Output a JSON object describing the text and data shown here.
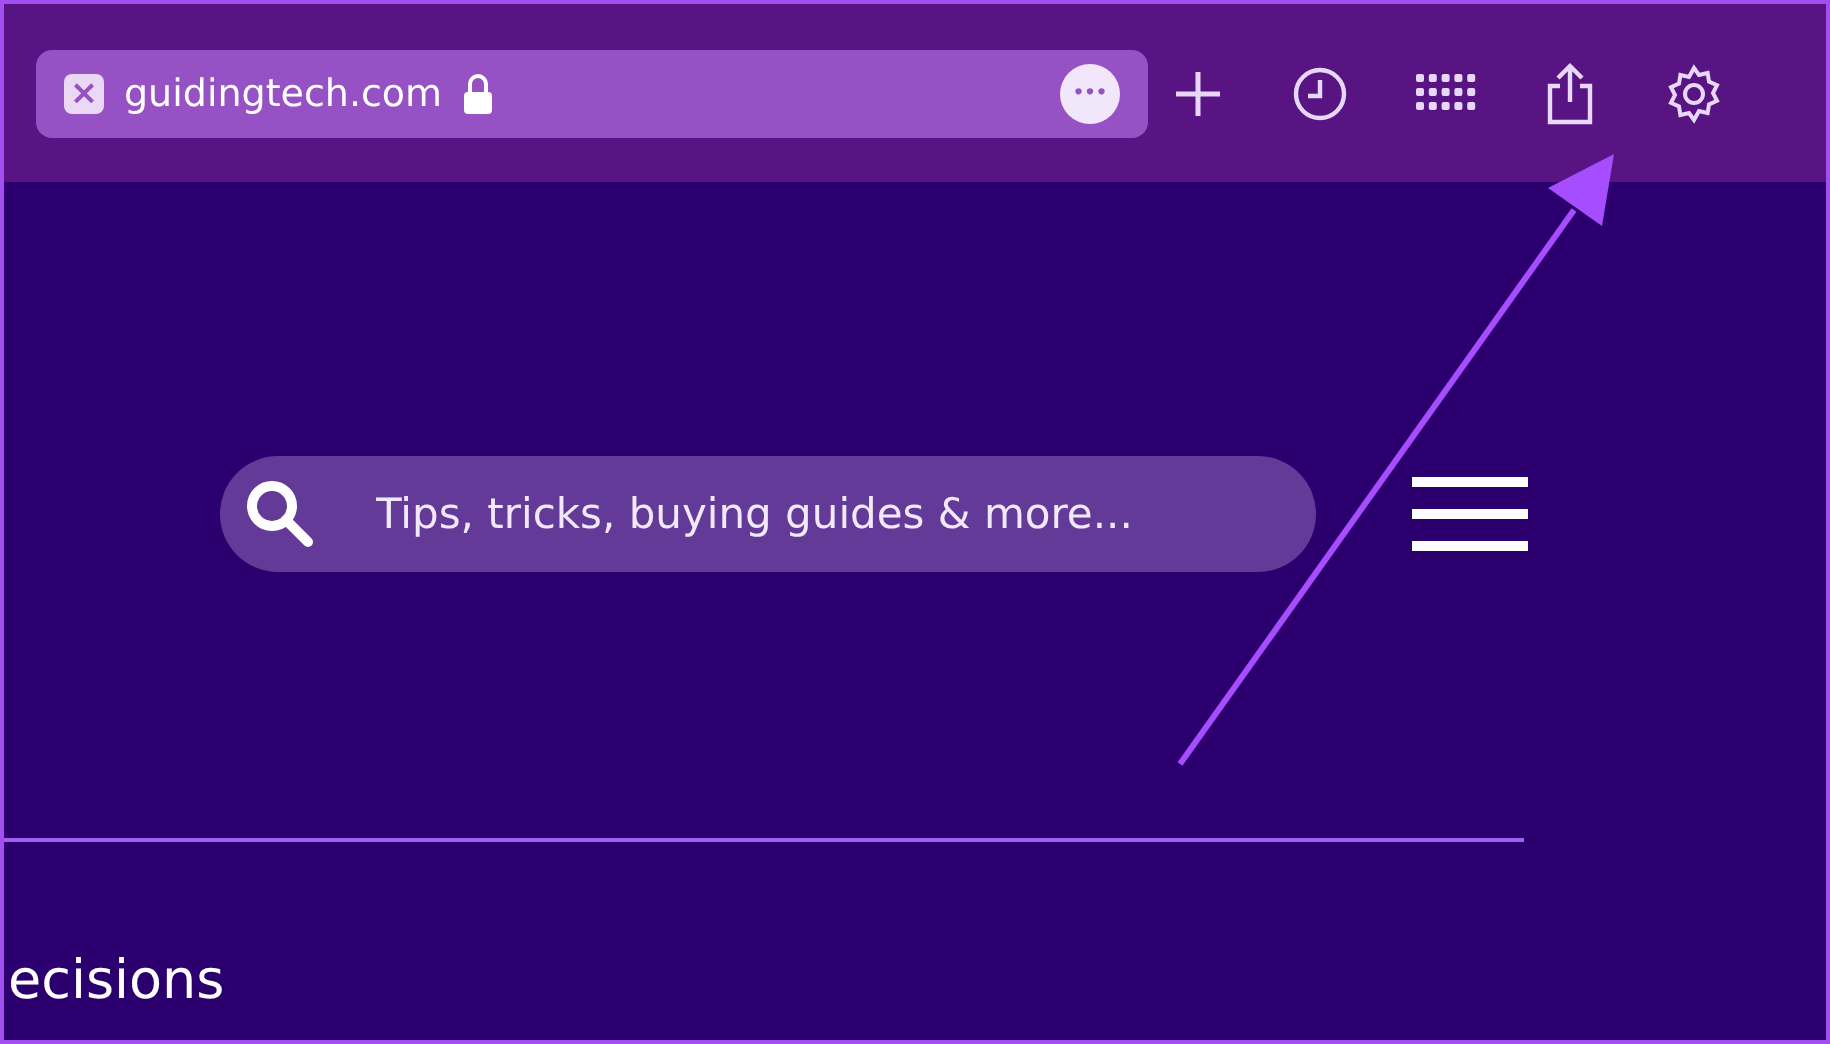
{
  "toolbar": {
    "tab_close": "×",
    "address": "guidingtech.com",
    "more": "•••",
    "buttons": [
      {
        "kind": "new-tab"
      },
      {
        "kind": "history"
      },
      {
        "kind": "apps"
      },
      {
        "kind": "share"
      },
      {
        "kind": "settings"
      }
    ]
  },
  "page": {
    "search": {
      "placeholder": "Tips, tricks, buying guides & more..."
    },
    "partial_heading": "ecisions"
  }
}
